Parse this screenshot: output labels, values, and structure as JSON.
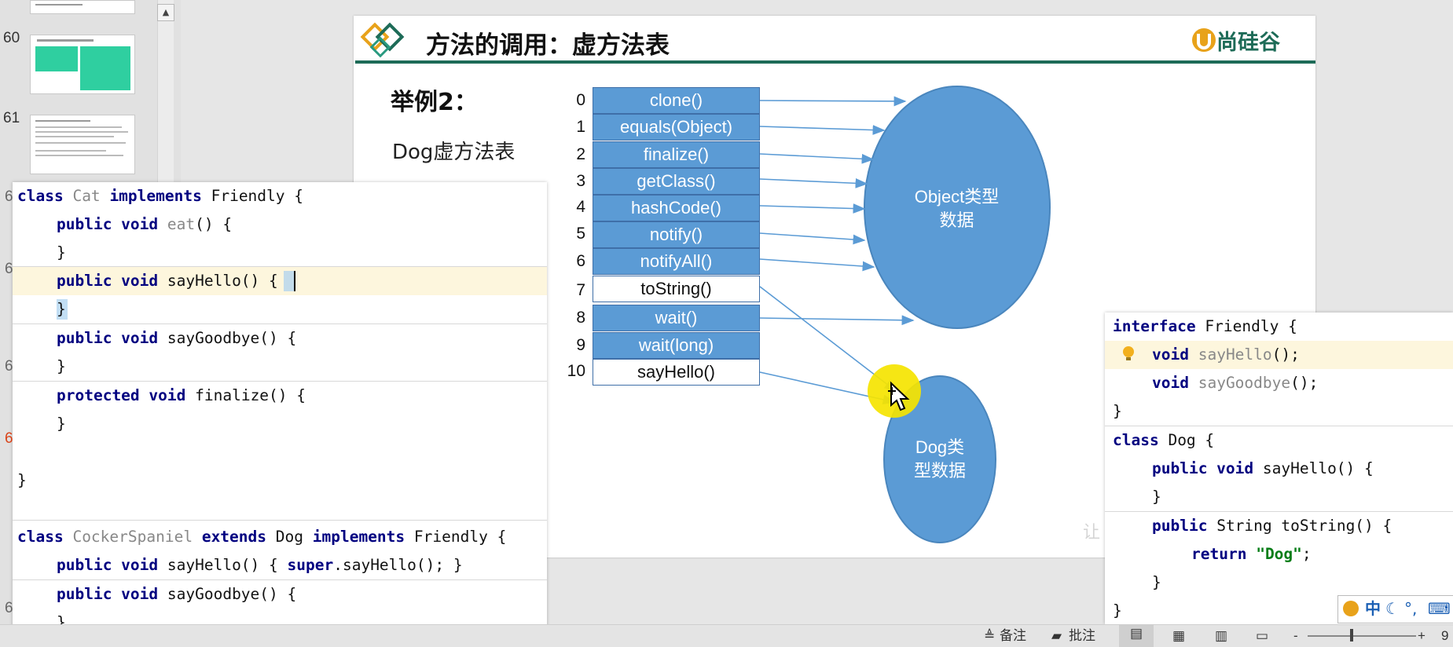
{
  "thumbnails": [
    {
      "number": "60"
    },
    {
      "number": "61"
    }
  ],
  "slide": {
    "title": "方法的调用：虚方法表",
    "logo_text": "尚硅谷",
    "example_label": "举例2：",
    "vtable_label": "Dog虚方法表",
    "vtable": [
      {
        "index": "0",
        "method": "clone()",
        "filled": true
      },
      {
        "index": "1",
        "method": "equals(Object)",
        "filled": true
      },
      {
        "index": "2",
        "method": "finalize()",
        "filled": true
      },
      {
        "index": "3",
        "method": "getClass()",
        "filled": true
      },
      {
        "index": "4",
        "method": "hashCode()",
        "filled": true
      },
      {
        "index": "5",
        "method": "notify()",
        "filled": true
      },
      {
        "index": "6",
        "method": "notifyAll()",
        "filled": true
      },
      {
        "index": "7",
        "method": "toString()",
        "filled": false
      },
      {
        "index": "8",
        "method": "wait()",
        "filled": true
      },
      {
        "index": "9",
        "method": "wait(long)",
        "filled": true
      },
      {
        "index": "10",
        "method": "sayHello()",
        "filled": false
      }
    ],
    "object_ellipse": {
      "line1": "Object类型",
      "line2": "数据"
    },
    "dog_ellipse": {
      "line1": "Dog类",
      "line2": "型数据"
    },
    "colors": {
      "cell_fill": "#5b9bd5",
      "ellipse": "#5b9bd5",
      "title_bar": "#1d6b57"
    }
  },
  "left_code": {
    "gutter": [
      "6",
      "6",
      "6",
      "6",
      "6"
    ],
    "lines": {
      "l1": {
        "kw1": "class",
        "name": "Cat",
        "kw2": "implements",
        "rest": "Friendly {"
      },
      "l2": {
        "kw": "public void",
        "name": "eat",
        "rest": "() {"
      },
      "l3": "}",
      "l4": {
        "kw": "public void",
        "rest": "sayHello() {"
      },
      "l5": "}",
      "l6": {
        "kw": "public void",
        "rest": "sayGoodbye() {"
      },
      "l7": "}",
      "l8": {
        "kw": "protected void",
        "rest": "finalize() {"
      },
      "l9": "}",
      "l10": "}",
      "l11": {
        "kw1": "class",
        "name": "CockerSpaniel",
        "kw2": "extends",
        "mid": "Dog",
        "kw3": "implements",
        "rest": "Friendly {"
      },
      "l12": {
        "kw": "public void",
        "pre": "sayHello() {",
        "kw2": "super",
        "rest": ".sayHello(); }"
      },
      "l13": {
        "kw": "public void",
        "rest": "sayGoodbye() {"
      },
      "l14": "}"
    }
  },
  "right_code": {
    "lines": {
      "r1": {
        "kw": "interface",
        "rest": "Friendly {"
      },
      "r2": {
        "kw": "void",
        "name": "sayHello",
        "rest": "();"
      },
      "r3": {
        "kw": "void",
        "name": "sayGoodbye",
        "rest": "();"
      },
      "r4": "}",
      "r5": {
        "kw": "class",
        "rest": "Dog {"
      },
      "r6": {
        "kw": "public void",
        "rest": "sayHello() {"
      },
      "r7": "}",
      "r8": {
        "kw": "public",
        "rest": "String toString() {"
      },
      "r9": {
        "kw": "return",
        "str": "\"Dog\"",
        "rest": ";"
      },
      "r10": "}",
      "r11": "}"
    }
  },
  "status_bar": {
    "notes_label": "备注",
    "comments_label": "批注",
    "zoom_minus": "-",
    "zoom_plus": "+",
    "zoom_value": "9"
  },
  "ime": {
    "chinese": "中",
    "punct": "°,"
  }
}
